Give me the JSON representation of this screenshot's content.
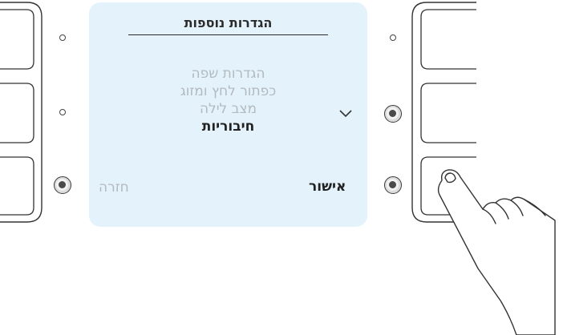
{
  "screen": {
    "title": "הגדרות נוספות",
    "menu_items": [
      {
        "label": "הגדרות שפה",
        "selected": false
      },
      {
        "label": "כפתור לחץ ומזוג",
        "selected": false
      },
      {
        "label": "מצב לילה",
        "selected": false
      },
      {
        "label": "חיבוריות",
        "selected": true
      }
    ],
    "scroll_indicator_icon": "chevron-down-icon",
    "back_label": "חזרה",
    "confirm_label": "אישור"
  },
  "left_keys": [
    {
      "name": "left-key-1",
      "indicator_lit": false
    },
    {
      "name": "left-key-2",
      "indicator_lit": false
    },
    {
      "name": "left-key-3",
      "indicator_lit": true
    }
  ],
  "right_keys": [
    {
      "name": "right-key-1",
      "indicator_lit": false
    },
    {
      "name": "right-key-2",
      "indicator_lit": true
    },
    {
      "name": "right-key-3",
      "indicator_lit": true
    }
  ],
  "pointer_icon": "hand-pointer-icon",
  "colors": {
    "screen_bg": "#e4f3fb",
    "text_active": "#222222",
    "text_inactive": "#b2b9bf",
    "outline": "#333333"
  }
}
